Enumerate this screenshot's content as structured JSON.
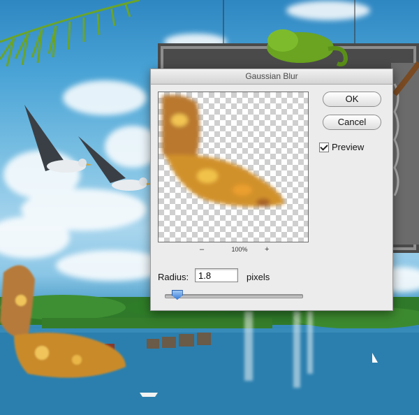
{
  "dialog": {
    "title": "Gaussian Blur",
    "ok_label": "OK",
    "cancel_label": "Cancel",
    "preview_label": "Preview",
    "preview_checked": true,
    "zoom": {
      "minus": "–",
      "value": "100%",
      "plus": "+"
    },
    "radius": {
      "label": "Radius:",
      "value": "1.8",
      "unit": "pixels",
      "slider_fraction": 0.09
    }
  },
  "colors": {
    "sky": "#4aa4d6",
    "water": "#2377a8",
    "dialog_bg": "#ececec",
    "slider_thumb": "#3c7fd8"
  },
  "icons": {
    "checkbox": "checkmark-icon",
    "slider": "slider-thumb-icon"
  }
}
